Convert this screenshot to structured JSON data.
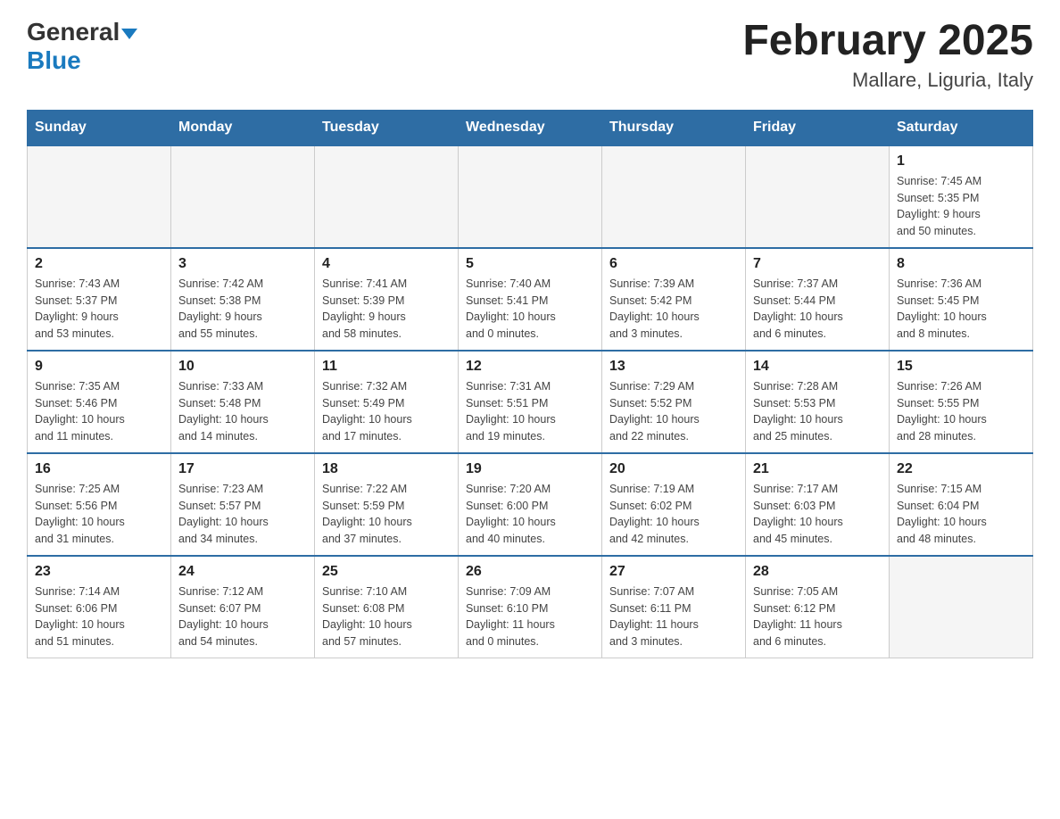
{
  "header": {
    "logo_general": "General",
    "logo_blue": "Blue",
    "logo_arrow": "▼",
    "month_title": "February 2025",
    "location": "Mallare, Liguria, Italy"
  },
  "days_of_week": [
    "Sunday",
    "Monday",
    "Tuesday",
    "Wednesday",
    "Thursday",
    "Friday",
    "Saturday"
  ],
  "weeks": [
    [
      {
        "day": "",
        "info": ""
      },
      {
        "day": "",
        "info": ""
      },
      {
        "day": "",
        "info": ""
      },
      {
        "day": "",
        "info": ""
      },
      {
        "day": "",
        "info": ""
      },
      {
        "day": "",
        "info": ""
      },
      {
        "day": "1",
        "info": "Sunrise: 7:45 AM\nSunset: 5:35 PM\nDaylight: 9 hours\nand 50 minutes."
      }
    ],
    [
      {
        "day": "2",
        "info": "Sunrise: 7:43 AM\nSunset: 5:37 PM\nDaylight: 9 hours\nand 53 minutes."
      },
      {
        "day": "3",
        "info": "Sunrise: 7:42 AM\nSunset: 5:38 PM\nDaylight: 9 hours\nand 55 minutes."
      },
      {
        "day": "4",
        "info": "Sunrise: 7:41 AM\nSunset: 5:39 PM\nDaylight: 9 hours\nand 58 minutes."
      },
      {
        "day": "5",
        "info": "Sunrise: 7:40 AM\nSunset: 5:41 PM\nDaylight: 10 hours\nand 0 minutes."
      },
      {
        "day": "6",
        "info": "Sunrise: 7:39 AM\nSunset: 5:42 PM\nDaylight: 10 hours\nand 3 minutes."
      },
      {
        "day": "7",
        "info": "Sunrise: 7:37 AM\nSunset: 5:44 PM\nDaylight: 10 hours\nand 6 minutes."
      },
      {
        "day": "8",
        "info": "Sunrise: 7:36 AM\nSunset: 5:45 PM\nDaylight: 10 hours\nand 8 minutes."
      }
    ],
    [
      {
        "day": "9",
        "info": "Sunrise: 7:35 AM\nSunset: 5:46 PM\nDaylight: 10 hours\nand 11 minutes."
      },
      {
        "day": "10",
        "info": "Sunrise: 7:33 AM\nSunset: 5:48 PM\nDaylight: 10 hours\nand 14 minutes."
      },
      {
        "day": "11",
        "info": "Sunrise: 7:32 AM\nSunset: 5:49 PM\nDaylight: 10 hours\nand 17 minutes."
      },
      {
        "day": "12",
        "info": "Sunrise: 7:31 AM\nSunset: 5:51 PM\nDaylight: 10 hours\nand 19 minutes."
      },
      {
        "day": "13",
        "info": "Sunrise: 7:29 AM\nSunset: 5:52 PM\nDaylight: 10 hours\nand 22 minutes."
      },
      {
        "day": "14",
        "info": "Sunrise: 7:28 AM\nSunset: 5:53 PM\nDaylight: 10 hours\nand 25 minutes."
      },
      {
        "day": "15",
        "info": "Sunrise: 7:26 AM\nSunset: 5:55 PM\nDaylight: 10 hours\nand 28 minutes."
      }
    ],
    [
      {
        "day": "16",
        "info": "Sunrise: 7:25 AM\nSunset: 5:56 PM\nDaylight: 10 hours\nand 31 minutes."
      },
      {
        "day": "17",
        "info": "Sunrise: 7:23 AM\nSunset: 5:57 PM\nDaylight: 10 hours\nand 34 minutes."
      },
      {
        "day": "18",
        "info": "Sunrise: 7:22 AM\nSunset: 5:59 PM\nDaylight: 10 hours\nand 37 minutes."
      },
      {
        "day": "19",
        "info": "Sunrise: 7:20 AM\nSunset: 6:00 PM\nDaylight: 10 hours\nand 40 minutes."
      },
      {
        "day": "20",
        "info": "Sunrise: 7:19 AM\nSunset: 6:02 PM\nDaylight: 10 hours\nand 42 minutes."
      },
      {
        "day": "21",
        "info": "Sunrise: 7:17 AM\nSunset: 6:03 PM\nDaylight: 10 hours\nand 45 minutes."
      },
      {
        "day": "22",
        "info": "Sunrise: 7:15 AM\nSunset: 6:04 PM\nDaylight: 10 hours\nand 48 minutes."
      }
    ],
    [
      {
        "day": "23",
        "info": "Sunrise: 7:14 AM\nSunset: 6:06 PM\nDaylight: 10 hours\nand 51 minutes."
      },
      {
        "day": "24",
        "info": "Sunrise: 7:12 AM\nSunset: 6:07 PM\nDaylight: 10 hours\nand 54 minutes."
      },
      {
        "day": "25",
        "info": "Sunrise: 7:10 AM\nSunset: 6:08 PM\nDaylight: 10 hours\nand 57 minutes."
      },
      {
        "day": "26",
        "info": "Sunrise: 7:09 AM\nSunset: 6:10 PM\nDaylight: 11 hours\nand 0 minutes."
      },
      {
        "day": "27",
        "info": "Sunrise: 7:07 AM\nSunset: 6:11 PM\nDaylight: 11 hours\nand 3 minutes."
      },
      {
        "day": "28",
        "info": "Sunrise: 7:05 AM\nSunset: 6:12 PM\nDaylight: 11 hours\nand 6 minutes."
      },
      {
        "day": "",
        "info": ""
      }
    ]
  ]
}
